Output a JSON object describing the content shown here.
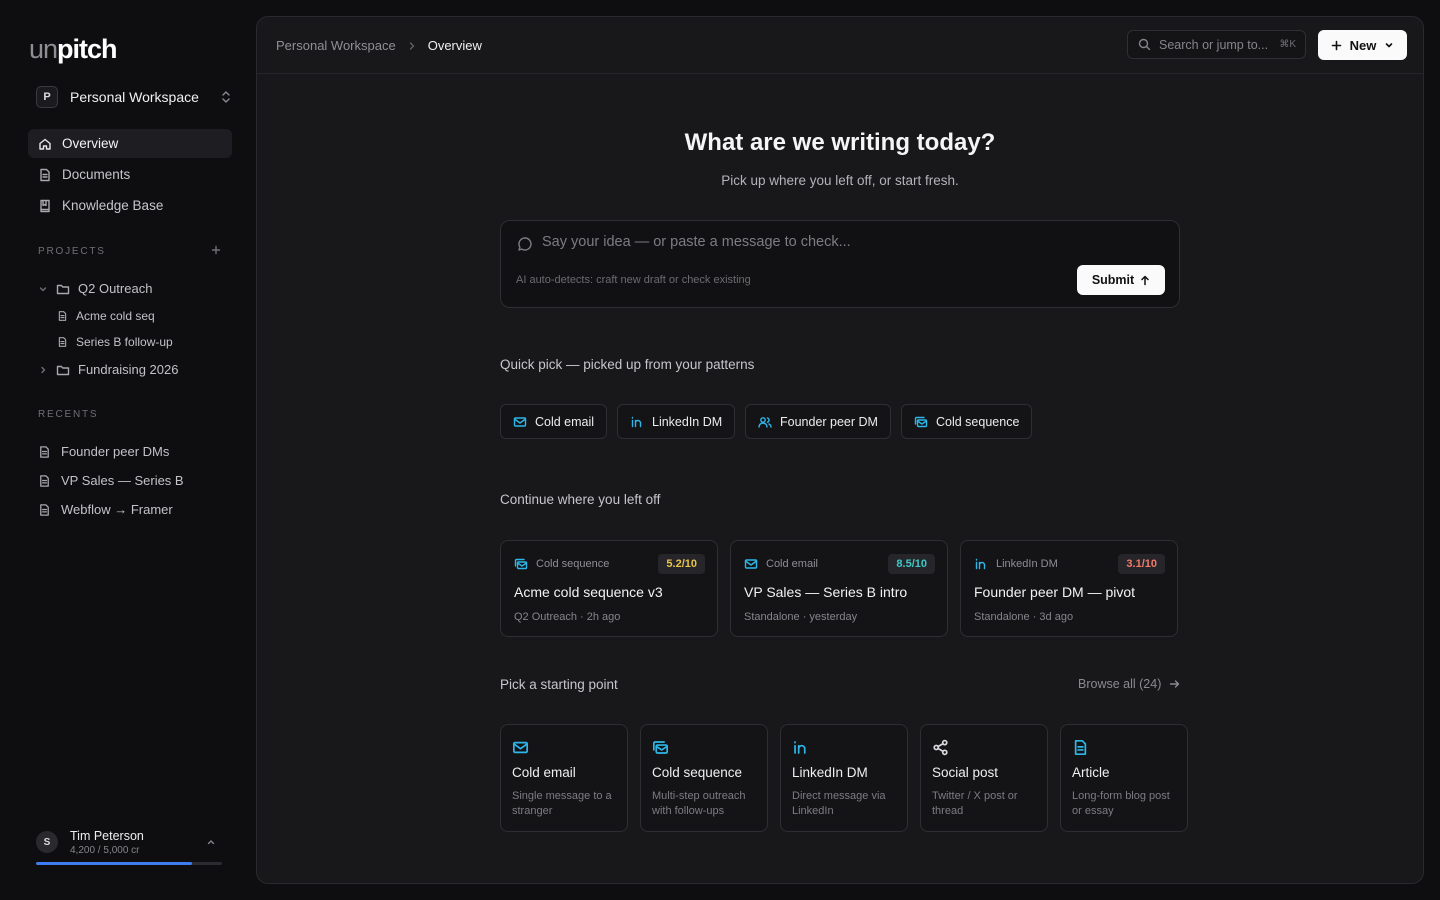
{
  "brand": {
    "logo_light": "un",
    "logo_bold": "pitch"
  },
  "workspace": {
    "badge": "P",
    "name": "Personal Workspace"
  },
  "nav": [
    {
      "label": "Overview",
      "icon": "home-icon",
      "active": true
    },
    {
      "label": "Documents",
      "icon": "document-icon",
      "active": false
    },
    {
      "label": "Knowledge Base",
      "icon": "book-icon",
      "active": false
    }
  ],
  "projects": {
    "label": "PROJECTS",
    "folders": [
      {
        "name": "Q2 Outreach",
        "expanded": true,
        "children": [
          "Acme cold seq",
          "Series B follow-up"
        ]
      },
      {
        "name": "Fundraising 2026",
        "expanded": false,
        "children": []
      }
    ]
  },
  "recents": {
    "label": "RECENTS",
    "items": [
      "Founder peer DMs",
      "VP Sales — Series B",
      "Webflow → Framer"
    ]
  },
  "user": {
    "initial": "S",
    "name": "Tim Peterson",
    "credits": "4,200 / 5,000 cr",
    "credit_fraction": 0.84,
    "credit_color": "#3f7cf2"
  },
  "topbar": {
    "breadcrumb_workspace": "Personal Workspace",
    "breadcrumb_current": "Overview",
    "search_placeholder": "Search or jump to...",
    "search_shortcut": "⌘K",
    "new_label": "New"
  },
  "hero": {
    "title": "What are we writing today?",
    "subtitle": "Pick up where you left off, or start fresh."
  },
  "composer": {
    "placeholder": "Say your idea — or paste a message to check...",
    "hint": "AI auto-detects: craft new draft or check existing",
    "submit_label": "Submit"
  },
  "quick_pick": {
    "title": "Quick pick — picked up from your patterns",
    "chips": [
      {
        "label": "Cold email",
        "icon": "mail-icon"
      },
      {
        "label": "LinkedIn DM",
        "icon": "linkedin-icon"
      },
      {
        "label": "Founder peer DM",
        "icon": "users-icon"
      },
      {
        "label": "Cold sequence",
        "icon": "mail-stack-icon"
      }
    ]
  },
  "continue": {
    "title": "Continue where you left off",
    "cards": [
      {
        "type": "Cold sequence",
        "icon": "mail-stack-icon",
        "score": "5.2/10",
        "score_color": "#e8c14a",
        "title": "Acme cold sequence v3",
        "meta": "Q2 Outreach · 2h ago"
      },
      {
        "type": "Cold email",
        "icon": "mail-icon",
        "score": "8.5/10",
        "score_color": "#3fc7c7",
        "title": "VP Sales — Series B intro",
        "meta": "Standalone · yesterday"
      },
      {
        "type": "LinkedIn DM",
        "icon": "linkedin-icon",
        "score": "3.1/10",
        "score_color": "#f07a6a",
        "title": "Founder peer DM — pivot",
        "meta": "Standalone · 3d ago"
      }
    ]
  },
  "starting": {
    "title": "Pick a starting point",
    "browse": "Browse all (24)",
    "templates": [
      {
        "title": "Cold email",
        "desc": "Single message to a stranger",
        "icon": "mail-icon"
      },
      {
        "title": "Cold sequence",
        "desc": "Multi-step outreach with follow-ups",
        "icon": "mail-stack-icon"
      },
      {
        "title": "LinkedIn DM",
        "desc": "Direct message via LinkedIn",
        "icon": "linkedin-icon"
      },
      {
        "title": "Social post",
        "desc": "Twitter / X post or thread",
        "icon": "share-icon"
      },
      {
        "title": "Article",
        "desc": "Long-form blog post or essay",
        "icon": "article-icon"
      }
    ]
  },
  "colors": {
    "accent": "#2fb6e8",
    "background": "#0e0e10",
    "panel": "#18181b"
  }
}
